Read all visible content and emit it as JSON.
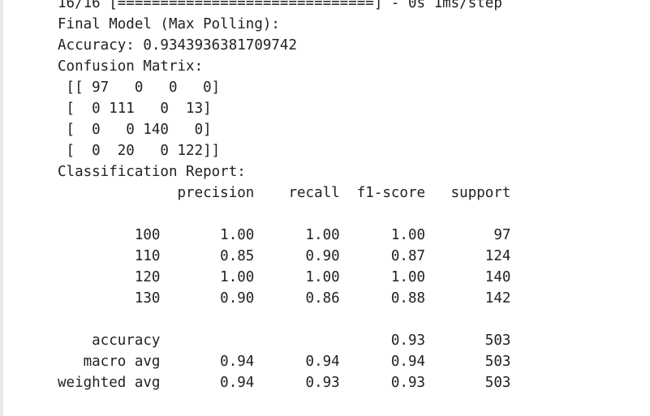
{
  "cell_output": {
    "lines": [
      "16/16 [==============================] - 0s 1ms/step",
      "Final Model (Max Polling):",
      "Accuracy: 0.9343936381709742",
      "Confusion Matrix:",
      " [[ 97   0   0   0]",
      " [  0 111   0  13]",
      " [  0   0 140   0]",
      " [  0  20   0 122]]",
      "Classification Report:",
      "              precision    recall  f1-score   support",
      "",
      "         100       1.00      1.00      1.00        97",
      "         110       0.85      0.90      0.87       124",
      "         120       1.00      1.00      1.00       140",
      "         130       0.90      0.86      0.88       142",
      "",
      "    accuracy                           0.93       503",
      "   macro avg       0.94      0.94      0.94       503",
      "weighted avg       0.94      0.93      0.93       503"
    ]
  }
}
